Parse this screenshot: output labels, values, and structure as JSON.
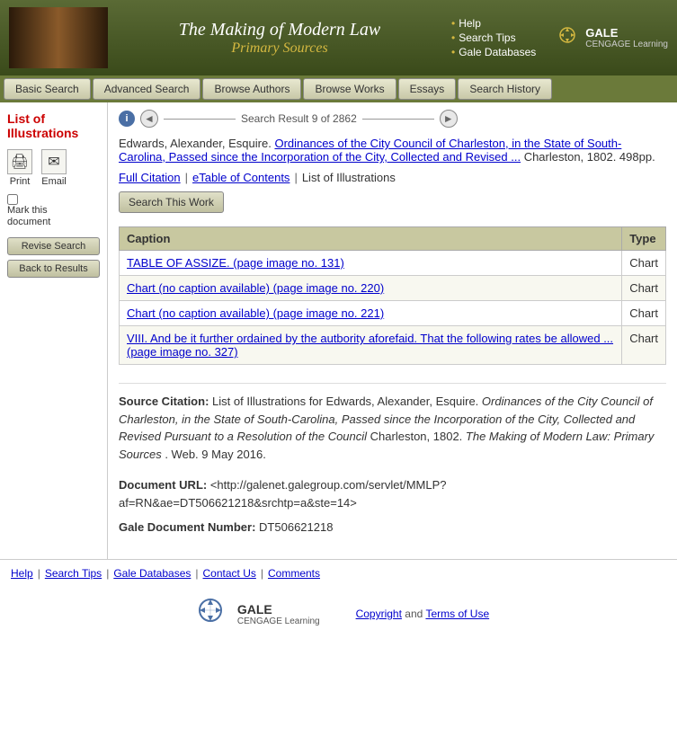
{
  "header": {
    "main_title": "The Making of Modern Law",
    "sub_title": "Primary Sources",
    "links": [
      {
        "label": "Help",
        "id": "help"
      },
      {
        "label": "Search Tips",
        "id": "search-tips"
      },
      {
        "label": "Gale Databases",
        "id": "gale-db"
      }
    ],
    "gale_label": "GALE",
    "cengage_label": "CENGAGE Learning"
  },
  "navbar": {
    "items": [
      {
        "label": "Basic Search",
        "id": "basic-search"
      },
      {
        "label": "Advanced Search",
        "id": "advanced-search"
      },
      {
        "label": "Browse Authors",
        "id": "browse-authors"
      },
      {
        "label": "Browse Works",
        "id": "browse-works"
      },
      {
        "label": "Essays",
        "id": "essays"
      },
      {
        "label": "Search History",
        "id": "search-history"
      }
    ]
  },
  "sidebar": {
    "title": "List of Illustrations",
    "print_label": "Print",
    "email_label": "Email",
    "mark_label": "Mark this\ndocument",
    "revise_search_label": "Revise Search",
    "back_to_results_label": "Back to Results"
  },
  "navigation": {
    "info_symbol": "i",
    "result_text": "Search Result 9 of 2862",
    "prev_symbol": "◄",
    "next_symbol": "►"
  },
  "citation": {
    "author": "Edwards, Alexander, Esquire.",
    "title_link": "Ordinances of the City Council of Charleston, in the State of South-Carolina, Passed since the Incorporation of the City, Collected and Revised ...",
    "publisher": "Charleston, 1802. 498pp.",
    "full_citation_label": "Full Citation",
    "etoc_label": "eTable of Contents",
    "list_label": "List of Illustrations",
    "search_work_label": "Search This Work"
  },
  "table": {
    "col_caption": "Caption",
    "col_type": "Type",
    "rows": [
      {
        "caption": "TABLE OF ASSIZE.  (page image no. 131)",
        "type": "Chart"
      },
      {
        "caption": "Chart (no caption available) (page image no. 220)",
        "type": "Chart"
      },
      {
        "caption": "Chart (no caption available) (page image no. 221)",
        "type": "Chart"
      },
      {
        "caption": "VIII. And be it further ordained by the autbority aforefaid. That the following rates be allowed ... (page image no. 327)",
        "type": "Chart"
      }
    ]
  },
  "source_citation": {
    "label": "Source Citation:",
    "text": "List of Illustrations for Edwards, Alexander, Esquire. ",
    "title_italic": "Ordinances of the City Council of Charleston, in the State of South-Carolina, Passed since the Incorporation of the City, Collected and Revised Pursuant to a Resolution of the Council",
    "text2": " Charleston, 1802. ",
    "publication_italic": "The Making of Modern Law: Primary Sources",
    "text3": ". Web. 9 May 2016."
  },
  "doc_url": {
    "label": "Document URL:",
    "url": "<http://galenet.galegroup.com/servlet/MMLP?af=RN&ae=DT506621218&srchtp=a&ste=14>"
  },
  "gale_doc": {
    "label": "Gale Document Number:",
    "number": "DT506621218"
  },
  "footer": {
    "links": [
      {
        "label": "Help"
      },
      {
        "label": "Search Tips"
      },
      {
        "label": "Gale Databases"
      },
      {
        "label": "Contact Us"
      },
      {
        "label": "Comments"
      }
    ],
    "copyright_text": "Copyright",
    "and_text": "and",
    "terms_text": "Terms of Use",
    "gale_label": "GALE",
    "cengage_label": "CENGAGE Learning"
  }
}
